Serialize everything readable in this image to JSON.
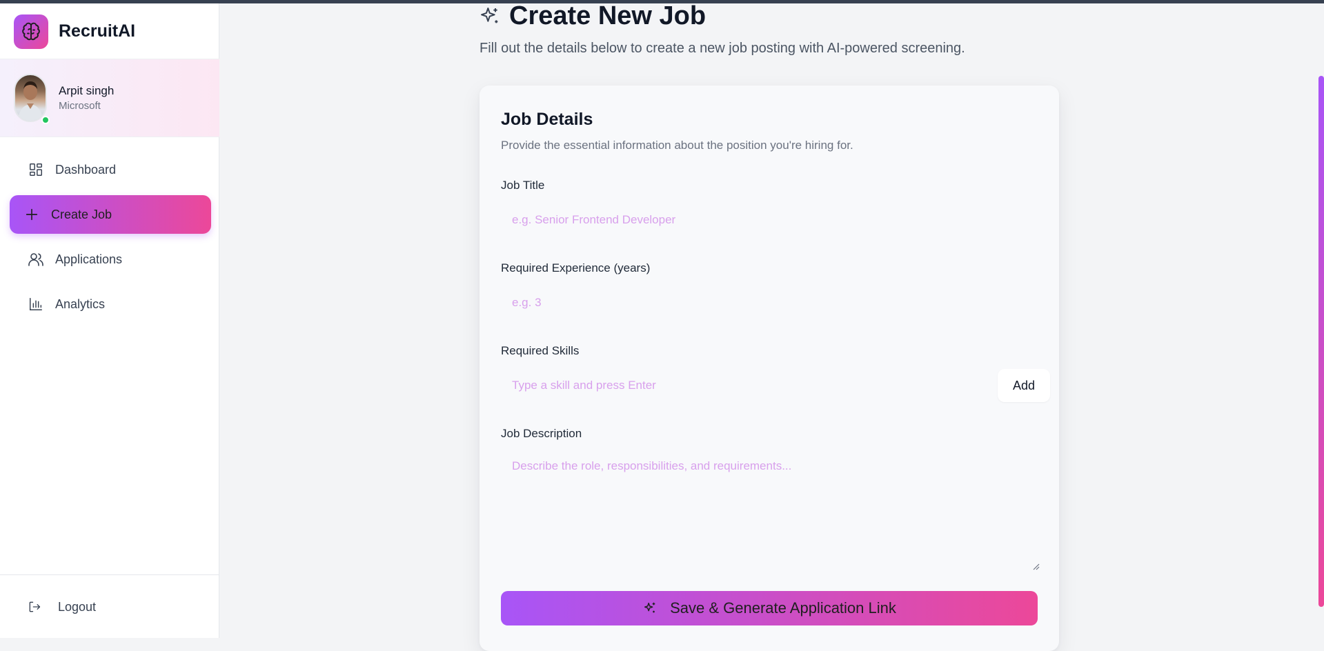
{
  "brand": {
    "name": "RecruitAI"
  },
  "user": {
    "name": "Arpit singh",
    "company": "Microsoft"
  },
  "nav": {
    "items": [
      {
        "label": "Dashboard",
        "icon": "dashboard-icon"
      },
      {
        "label": "Create Job",
        "icon": "plus-icon",
        "active": true
      },
      {
        "label": "Applications",
        "icon": "users-icon"
      },
      {
        "label": "Analytics",
        "icon": "bar-chart-icon"
      }
    ],
    "logout": "Logout"
  },
  "page": {
    "title": "Create New Job",
    "subtitle": "Fill out the details below to create a new job posting with AI-powered screening."
  },
  "card": {
    "title": "Job Details",
    "description": "Provide the essential information about the position you're hiring for.",
    "fields": {
      "job_title": {
        "label": "Job Title",
        "placeholder": "e.g. Senior Frontend Developer",
        "value": ""
      },
      "experience": {
        "label": "Required Experience (years)",
        "placeholder": "e.g. 3",
        "value": ""
      },
      "skills": {
        "label": "Required Skills",
        "placeholder": "Type a skill and press Enter",
        "value": "",
        "add_label": "Add"
      },
      "description": {
        "label": "Job Description",
        "placeholder": "Describe the role, responsibilities, and requirements...",
        "value": ""
      }
    },
    "submit_label": "Save & Generate Application Link"
  },
  "colors": {
    "accent_start": "#a855f7",
    "accent_end": "#ec4899",
    "placeholder": "#d8a0ec",
    "online": "#22c55e"
  }
}
